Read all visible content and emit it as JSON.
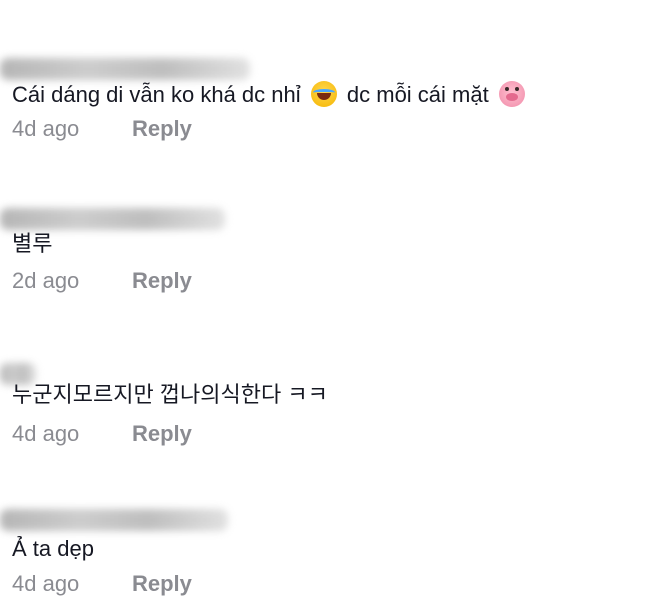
{
  "comments": [
    {
      "text_before": "Cái dáng di vẫn ko khá dc nhỉ",
      "text_middle": "dc mỗi cái mặt",
      "time": "4d ago",
      "reply_label": "Reply",
      "emoji_1": "laughing-face-emoji",
      "emoji_2": "pig-face-emoji"
    },
    {
      "text": "별루",
      "time": "2d ago",
      "reply_label": "Reply"
    },
    {
      "text": "누군지모르지만 껍나의식한다 ㅋㅋ",
      "time": "4d ago",
      "reply_label": "Reply"
    },
    {
      "text": "Ả ta dẹp",
      "time": "4d ago",
      "reply_label": "Reply"
    }
  ]
}
